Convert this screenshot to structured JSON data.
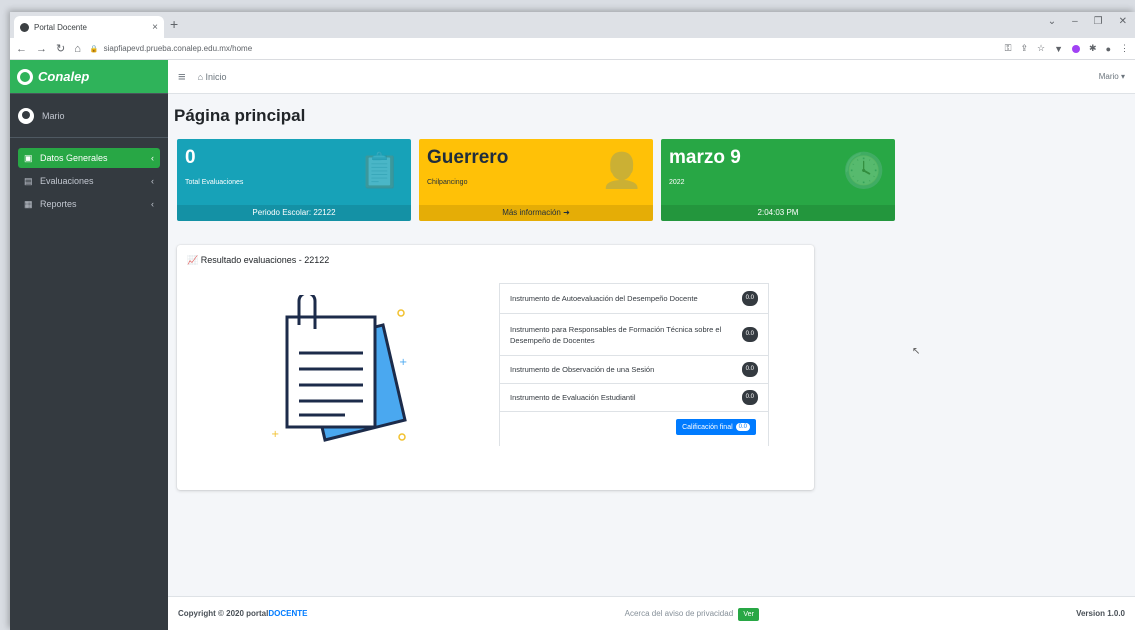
{
  "browser": {
    "tab_title": "Portal Docente",
    "tab_close": "×",
    "new_tab": "+",
    "url": "siapfiapevd.prueba.conalep.edu.mx/home",
    "window_controls": [
      "⌄",
      "–",
      "❐",
      "✕"
    ]
  },
  "sidebar": {
    "brand": "Conalep",
    "user": "Mario",
    "items": [
      {
        "label": "Datos Generales",
        "icon": "id-card-icon",
        "active": true
      },
      {
        "label": "Evaluaciones",
        "icon": "tasks-icon",
        "active": false
      },
      {
        "label": "Reportes",
        "icon": "chart-icon",
        "active": false
      }
    ]
  },
  "topnav": {
    "home_label": "Inicio",
    "user_menu": "Mario ▾"
  },
  "page": {
    "title": "Página principal"
  },
  "boxes": [
    {
      "value": "0",
      "text": "Total Evaluaciones",
      "footer": "Periodo Escolar: 22122",
      "icon": "clipboard-icon",
      "color": "#17a2b8"
    },
    {
      "value": "Guerrero",
      "text": "Chilpancingo",
      "footer": "Más información ➜",
      "icon": "user-icon",
      "color": "#ffc107"
    },
    {
      "value": "marzo 9",
      "text": "2022",
      "footer": "2:04:03 PM",
      "icon": "clock-icon",
      "color": "#28a745"
    }
  ],
  "results": {
    "title": "Resultado evaluaciones - 22122",
    "items": [
      {
        "label": "Instrumento de Autoevaluación del Desempeño Docente",
        "score": "0.0"
      },
      {
        "label": "Instrumento para Responsables de Formación Técnica sobre el Desempeño de Docentes",
        "score": "0.0"
      },
      {
        "label": "Instrumento de Observación de una Sesión",
        "score": "0.0"
      },
      {
        "label": "Instrumento de Evaluación Estudiantil",
        "score": "0.0"
      }
    ],
    "final_label": "Calificación final",
    "final_score": "0.0"
  },
  "footer": {
    "copyright": "Copyright © 2020 portal",
    "copyright_brand": "DOCENTE",
    "privacy": "Acerca del aviso de privacidad",
    "privacy_button": "Ver",
    "version": "Version 1.0.0"
  }
}
